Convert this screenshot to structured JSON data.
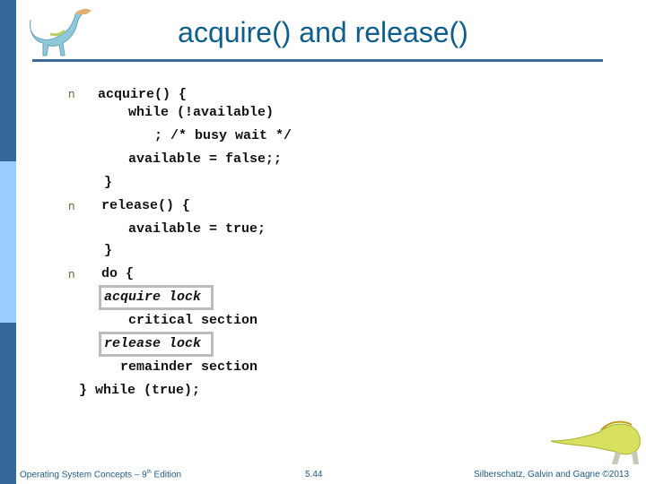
{
  "slide": {
    "title": "acquire() and release()",
    "bullets": [
      {
        "marker": "n",
        "lines": [
          "acquire() {",
          "while (!available)",
          "; /* busy wait */",
          "available = false;;",
          "}"
        ]
      },
      {
        "marker": "n",
        "lines": [
          "release() {",
          "available = true;",
          "}"
        ]
      },
      {
        "marker": "n",
        "lines": [
          "do {",
          "acquire lock",
          "critical section",
          "release lock",
          "remainder section",
          "} while (true);"
        ]
      }
    ]
  },
  "footer": {
    "book": "Operating System Concepts – 9",
    "book_sup": "th",
    "book_suffix": " Edition",
    "page": "5.44",
    "copyright": "Silberschatz, Galvin and Gagne ©2013"
  },
  "colors": {
    "sidebar_dark": "#336699",
    "sidebar_light": "#99ccff",
    "title": "#0e5e8c",
    "rule": "#3d6b94"
  }
}
